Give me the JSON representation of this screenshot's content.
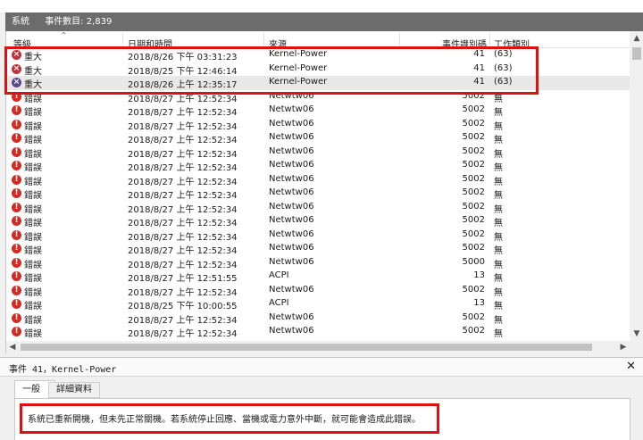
{
  "title_bar": {
    "log_name": "系統",
    "count_label": "事件數目: 2,839"
  },
  "columns": [
    "等級",
    "日期和時間",
    "來源",
    "事件識別碼",
    "工作類別"
  ],
  "rows": [
    {
      "level": "重大",
      "datetime": "2018/8/26 下午 03:31:23",
      "source": "Kernel-Power",
      "event_id": "41",
      "task": "(63)",
      "icon": "critical-icon"
    },
    {
      "level": "重大",
      "datetime": "2018/8/25 下午 12:46:14",
      "source": "Kernel-Power",
      "event_id": "41",
      "task": "(63)",
      "icon": "critical-icon"
    },
    {
      "level": "重大",
      "datetime": "2018/8/26 上午 12:35:17",
      "source": "Kernel-Power",
      "event_id": "41",
      "task": "(63)",
      "icon": "critical-icon"
    },
    {
      "level": "錯誤",
      "datetime": "2018/8/27 上午 12:52:34",
      "source": "Netwtw06",
      "event_id": "5002",
      "task": "無",
      "icon": "error-icon"
    },
    {
      "level": "錯誤",
      "datetime": "2018/8/27 上午 12:52:34",
      "source": "Netwtw06",
      "event_id": "5002",
      "task": "無",
      "icon": "error-icon"
    },
    {
      "level": "錯誤",
      "datetime": "2018/8/27 上午 12:52:34",
      "source": "Netwtw06",
      "event_id": "5002",
      "task": "無",
      "icon": "error-icon"
    },
    {
      "level": "錯誤",
      "datetime": "2018/8/27 上午 12:52:34",
      "source": "Netwtw06",
      "event_id": "5002",
      "task": "無",
      "icon": "error-icon"
    },
    {
      "level": "錯誤",
      "datetime": "2018/8/27 上午 12:52:34",
      "source": "Netwtw06",
      "event_id": "5002",
      "task": "無",
      "icon": "error-icon"
    },
    {
      "level": "錯誤",
      "datetime": "2018/8/27 上午 12:52:34",
      "source": "Netwtw06",
      "event_id": "5002",
      "task": "無",
      "icon": "error-icon"
    },
    {
      "level": "錯誤",
      "datetime": "2018/8/27 上午 12:52:34",
      "source": "Netwtw06",
      "event_id": "5002",
      "task": "無",
      "icon": "error-icon"
    },
    {
      "level": "錯誤",
      "datetime": "2018/8/27 上午 12:52:34",
      "source": "Netwtw06",
      "event_id": "5002",
      "task": "無",
      "icon": "error-icon"
    },
    {
      "level": "錯誤",
      "datetime": "2018/8/27 上午 12:52:34",
      "source": "Netwtw06",
      "event_id": "5002",
      "task": "無",
      "icon": "error-icon"
    },
    {
      "level": "錯誤",
      "datetime": "2018/8/27 上午 12:52:34",
      "source": "Netwtw06",
      "event_id": "5002",
      "task": "無",
      "icon": "error-icon"
    },
    {
      "level": "錯誤",
      "datetime": "2018/8/27 上午 12:52:34",
      "source": "Netwtw06",
      "event_id": "5002",
      "task": "無",
      "icon": "error-icon"
    },
    {
      "level": "錯誤",
      "datetime": "2018/8/27 上午 12:52:34",
      "source": "Netwtw06",
      "event_id": "5002",
      "task": "無",
      "icon": "error-icon"
    },
    {
      "level": "錯誤",
      "datetime": "2018/8/27 上午 12:52:34",
      "source": "Netwtw06",
      "event_id": "5000",
      "task": "無",
      "icon": "error-icon"
    },
    {
      "level": "錯誤",
      "datetime": "2018/8/27 上午 12:51:55",
      "source": "ACPI",
      "event_id": "13",
      "task": "無",
      "icon": "error-icon"
    },
    {
      "level": "錯誤",
      "datetime": "2018/8/27 上午 12:52:34",
      "source": "Netwtw06",
      "event_id": "5002",
      "task": "無",
      "icon": "error-icon"
    },
    {
      "level": "錯誤",
      "datetime": "2018/8/25 下午 10:00:55",
      "source": "ACPI",
      "event_id": "13",
      "task": "無",
      "icon": "error-icon"
    },
    {
      "level": "錯誤",
      "datetime": "2018/8/27 上午 12:52:34",
      "source": "Netwtw06",
      "event_id": "5002",
      "task": "無",
      "icon": "error-icon"
    },
    {
      "level": "錯誤",
      "datetime": "2018/8/27 上午 12:52:34",
      "source": "Netwtw06",
      "event_id": "5002",
      "task": "無",
      "icon": "error-icon"
    }
  ],
  "detail": {
    "header": "事件 41，Kernel-Power",
    "tabs": [
      "一般",
      "詳細資料"
    ],
    "message": "系統已重新開機，但未先正常關機。若系統停止回應、當機或電力意外中斷，就可能會造成此錯誤。"
  },
  "icons": {
    "critical": "critical-x-icon",
    "error": "error-exclamation-icon",
    "close": "close-icon"
  },
  "colors": {
    "highlight_box": "#dd1111",
    "title_bar": "#6c6c6c"
  }
}
